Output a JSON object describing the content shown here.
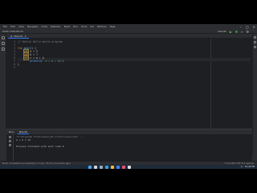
{
  "menu": [
    "File",
    "Edit",
    "View",
    "Navigate",
    "Code",
    "Refactor",
    "Build",
    "Run",
    "Tools",
    "Git",
    "Window",
    "Help"
  ],
  "project": "Kotlin-HelloWorld",
  "file_tab": "Main.kt",
  "run_config": "MainKt",
  "editor": {
    "line_numbers": [
      "1",
      "2",
      "3",
      "4",
      "5",
      "6",
      "7",
      "8",
      "9"
    ],
    "lines": [
      {
        "parts": [
          {
            "t": "// ",
            "c": "cm"
          },
          {
            "t": "Kotlin Hello World program",
            "c": "cm"
          }
        ]
      },
      {
        "parts": []
      },
      {
        "parts": [
          {
            "t": "fun ",
            "c": "kw"
          },
          {
            "t": "main",
            "c": "fn"
          },
          {
            "t": "() {",
            "c": ""
          }
        ]
      },
      {
        "parts": [
          {
            "t": "    ",
            "c": ""
          },
          {
            "t": "val",
            "c": "kw hl"
          },
          {
            "t": " a = 5",
            "c": ""
          }
        ]
      },
      {
        "parts": [
          {
            "t": "    ",
            "c": ""
          },
          {
            "t": "val",
            "c": "kw hl"
          },
          {
            "t": " b = 7",
            "c": ""
          }
        ]
      },
      {
        "parts": [
          {
            "t": "    ",
            "c": ""
          },
          {
            "t": "val",
            "c": "kw hl"
          },
          {
            "t": " c = a + b",
            "c": ""
          }
        ]
      },
      {
        "parts": [
          {
            "t": "        ",
            "c": ""
          },
          {
            "t": "println",
            "c": "fn"
          },
          {
            "t": "(",
            "c": ""
          },
          {
            "t": "\" a + b = $c\"",
            "c": "str"
          },
          {
            "t": ")",
            "c": ""
          }
        ]
      },
      {
        "parts": [
          {
            "t": "}",
            "c": ""
          }
        ]
      },
      {
        "parts": []
      }
    ]
  },
  "run_panel": {
    "header_label": "Run:",
    "tab": "MainKt",
    "console": [
      {
        "text": "\"C:\\Program Files\\Java\\jdk-17\\bin\\java.exe\" ...",
        "cls": "path"
      },
      {
        "text": "a + b = 12",
        "cls": ""
      },
      {
        "text": "",
        "cls": ""
      },
      {
        "text": "Process finished with exit code 0",
        "cls": ""
      }
    ]
  },
  "status": {
    "left": "Build completed successfully in 2 sec, 45 ms (moments ago)",
    "right": "7:24  CRLF  UTF-8  4 spaces"
  },
  "taskbar": {
    "icons": [
      "start",
      "search",
      "taskview",
      "edge",
      "explorer",
      "store",
      "intellij",
      "chrome"
    ],
    "icon_colors": [
      "#4aa3ff",
      "#cfd8e3",
      "#9ab",
      "#2f9fe8",
      "#f0c040",
      "#3b82f6",
      "#e64f7a",
      "#e0e0e0"
    ],
    "clock": "10:42 PM"
  }
}
